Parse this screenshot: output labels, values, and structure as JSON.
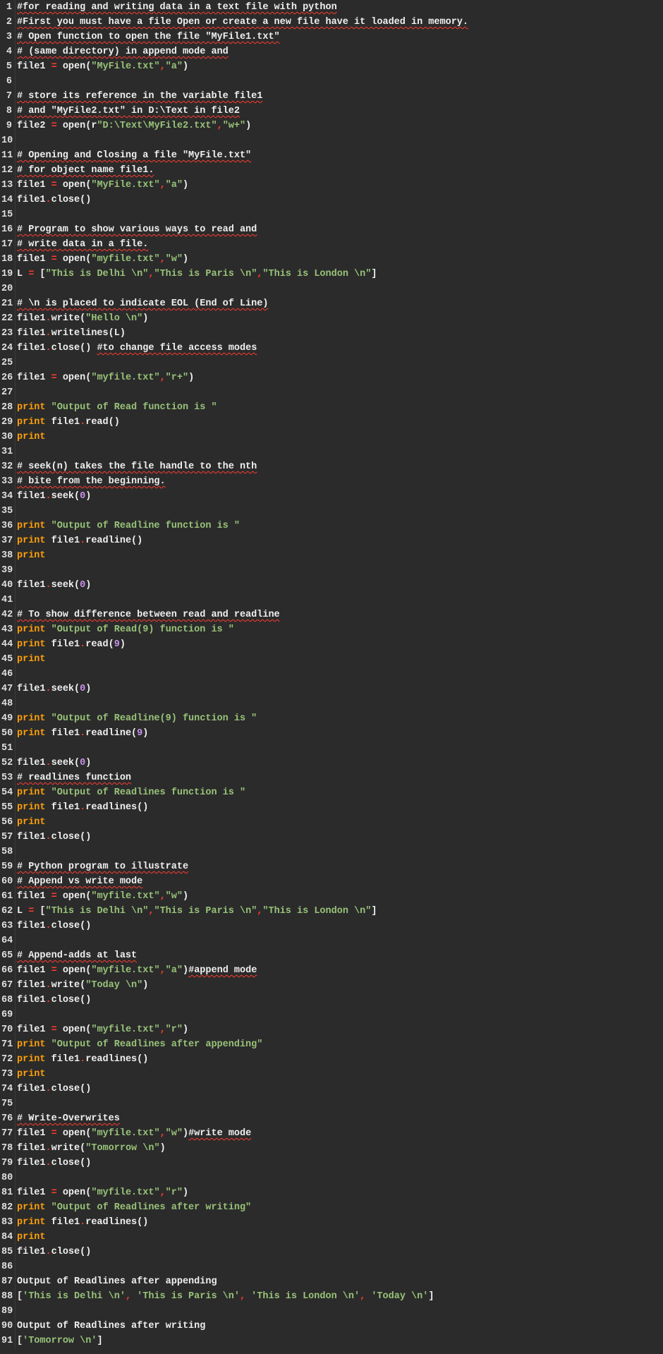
{
  "lines": [
    [
      [
        "comment squiggle",
        "#for reading and writing data in a text file with python"
      ]
    ],
    [
      [
        "comment squiggle",
        "#First you must have a file Open or create a new file have it loaded in memory."
      ]
    ],
    [
      [
        "comment squiggle",
        "# Open function to open the file \"MyFile1.txt\""
      ]
    ],
    [
      [
        "comment squiggle",
        "# (same directory) in append mode and"
      ]
    ],
    [
      [
        "ident",
        "file1 "
      ],
      [
        "op",
        "="
      ],
      [
        "ident",
        " open"
      ],
      [
        "paren",
        "("
      ],
      [
        "str",
        "\"MyFile.txt\""
      ],
      [
        "op",
        ","
      ],
      [
        "str",
        "\"a\""
      ],
      [
        "paren",
        ")"
      ]
    ],
    [
      [
        "ident",
        ""
      ]
    ],
    [
      [
        "comment squiggle",
        "# store its reference in the variable file1"
      ]
    ],
    [
      [
        "comment squiggle",
        "# and \"MyFile2.txt\" in D:\\Text in file2"
      ]
    ],
    [
      [
        "ident",
        "file2 "
      ],
      [
        "op",
        "="
      ],
      [
        "ident",
        " open"
      ],
      [
        "paren",
        "("
      ],
      [
        "ident",
        "r"
      ],
      [
        "str",
        "\"D:\\Text\\MyFile2.txt\""
      ],
      [
        "op",
        ","
      ],
      [
        "str",
        "\"w+\""
      ],
      [
        "paren",
        ")"
      ]
    ],
    [
      [
        "ident",
        ""
      ]
    ],
    [
      [
        "comment squiggle",
        "# Opening and Closing a file \"MyFile.txt\""
      ]
    ],
    [
      [
        "comment squiggle",
        "# for object name file1."
      ]
    ],
    [
      [
        "ident",
        "file1 "
      ],
      [
        "op",
        "="
      ],
      [
        "ident",
        " open"
      ],
      [
        "paren",
        "("
      ],
      [
        "str",
        "\"MyFile.txt\""
      ],
      [
        "op",
        ","
      ],
      [
        "str",
        "\"a\""
      ],
      [
        "paren",
        ")"
      ]
    ],
    [
      [
        "ident",
        "file1"
      ],
      [
        "op",
        "."
      ],
      [
        "ident",
        "close"
      ],
      [
        "paren",
        "()"
      ]
    ],
    [
      [
        "ident",
        ""
      ]
    ],
    [
      [
        "comment squiggle",
        "# Program to show various ways to read and"
      ]
    ],
    [
      [
        "comment squiggle",
        "# write data in a file."
      ]
    ],
    [
      [
        "ident",
        "file1 "
      ],
      [
        "op",
        "="
      ],
      [
        "ident",
        " open"
      ],
      [
        "paren",
        "("
      ],
      [
        "str",
        "\"myfile.txt\""
      ],
      [
        "op",
        ","
      ],
      [
        "str",
        "\"w\""
      ],
      [
        "paren",
        ")"
      ]
    ],
    [
      [
        "ident",
        "L "
      ],
      [
        "op",
        "="
      ],
      [
        "ident",
        " "
      ],
      [
        "paren",
        "["
      ],
      [
        "str",
        "\"This is Delhi \\n\""
      ],
      [
        "op",
        ","
      ],
      [
        "str",
        "\"This is Paris \\n\""
      ],
      [
        "op",
        ","
      ],
      [
        "str",
        "\"This is London \\n\""
      ],
      [
        "paren",
        "]"
      ]
    ],
    [
      [
        "ident",
        ""
      ]
    ],
    [
      [
        "comment squiggle",
        "# \\n is placed to indicate EOL (End of Line)"
      ]
    ],
    [
      [
        "ident",
        "file1"
      ],
      [
        "op",
        "."
      ],
      [
        "ident",
        "write"
      ],
      [
        "paren",
        "("
      ],
      [
        "str",
        "\"Hello \\n\""
      ],
      [
        "paren",
        ")"
      ]
    ],
    [
      [
        "ident",
        "file1"
      ],
      [
        "op",
        "."
      ],
      [
        "ident",
        "writelines"
      ],
      [
        "paren",
        "("
      ],
      [
        "ident",
        "L"
      ],
      [
        "paren",
        ")"
      ]
    ],
    [
      [
        "ident",
        "file1"
      ],
      [
        "op",
        "."
      ],
      [
        "ident",
        "close"
      ],
      [
        "paren",
        "() "
      ],
      [
        "comment squiggle",
        "#to change file access modes"
      ]
    ],
    [
      [
        "ident",
        ""
      ]
    ],
    [
      [
        "ident",
        "file1 "
      ],
      [
        "op",
        "="
      ],
      [
        "ident",
        " open"
      ],
      [
        "paren",
        "("
      ],
      [
        "str",
        "\"myfile.txt\""
      ],
      [
        "op",
        ","
      ],
      [
        "str",
        "\"r+\""
      ],
      [
        "paren",
        ")"
      ]
    ],
    [
      [
        "ident",
        ""
      ]
    ],
    [
      [
        "kw",
        "print "
      ],
      [
        "str",
        "\"Output of Read function is \""
      ]
    ],
    [
      [
        "kw",
        "print "
      ],
      [
        "ident",
        "file1"
      ],
      [
        "op",
        "."
      ],
      [
        "ident",
        "read"
      ],
      [
        "paren",
        "()"
      ]
    ],
    [
      [
        "kw",
        "print"
      ]
    ],
    [
      [
        "ident",
        ""
      ]
    ],
    [
      [
        "comment squiggle",
        "# seek(n) takes the file handle to the nth"
      ]
    ],
    [
      [
        "comment squiggle",
        "# bite from the beginning."
      ]
    ],
    [
      [
        "ident",
        "file1"
      ],
      [
        "op",
        "."
      ],
      [
        "ident",
        "seek"
      ],
      [
        "paren",
        "("
      ],
      [
        "numlit",
        "0"
      ],
      [
        "paren",
        ")"
      ]
    ],
    [
      [
        "ident",
        ""
      ]
    ],
    [
      [
        "kw",
        "print "
      ],
      [
        "str",
        "\"Output of Readline function is \""
      ]
    ],
    [
      [
        "kw",
        "print "
      ],
      [
        "ident",
        "file1"
      ],
      [
        "op",
        "."
      ],
      [
        "ident",
        "readline"
      ],
      [
        "paren",
        "()"
      ]
    ],
    [
      [
        "kw",
        "print"
      ]
    ],
    [
      [
        "ident",
        ""
      ]
    ],
    [
      [
        "ident",
        "file1"
      ],
      [
        "op",
        "."
      ],
      [
        "ident",
        "seek"
      ],
      [
        "paren",
        "("
      ],
      [
        "numlit",
        "0"
      ],
      [
        "paren",
        ")"
      ]
    ],
    [
      [
        "ident",
        ""
      ]
    ],
    [
      [
        "comment squiggle",
        "# To show difference between read and readline"
      ]
    ],
    [
      [
        "kw",
        "print "
      ],
      [
        "str",
        "\"Output of Read(9) function is \""
      ]
    ],
    [
      [
        "kw",
        "print "
      ],
      [
        "ident",
        "file1"
      ],
      [
        "op",
        "."
      ],
      [
        "ident",
        "read"
      ],
      [
        "paren",
        "("
      ],
      [
        "numlit",
        "9"
      ],
      [
        "paren",
        ")"
      ]
    ],
    [
      [
        "kw",
        "print"
      ]
    ],
    [
      [
        "ident",
        ""
      ]
    ],
    [
      [
        "ident",
        "file1"
      ],
      [
        "op",
        "."
      ],
      [
        "ident",
        "seek"
      ],
      [
        "paren",
        "("
      ],
      [
        "numlit",
        "0"
      ],
      [
        "paren",
        ")"
      ]
    ],
    [
      [
        "ident",
        ""
      ]
    ],
    [
      [
        "kw",
        "print "
      ],
      [
        "str",
        "\"Output of Readline(9) function is \""
      ]
    ],
    [
      [
        "kw",
        "print "
      ],
      [
        "ident",
        "file1"
      ],
      [
        "op",
        "."
      ],
      [
        "ident",
        "readline"
      ],
      [
        "paren",
        "("
      ],
      [
        "numlit",
        "9"
      ],
      [
        "paren",
        ")"
      ]
    ],
    [
      [
        "ident",
        ""
      ]
    ],
    [
      [
        "ident",
        "file1"
      ],
      [
        "op",
        "."
      ],
      [
        "ident",
        "seek"
      ],
      [
        "paren",
        "("
      ],
      [
        "numlit",
        "0"
      ],
      [
        "paren",
        ")"
      ]
    ],
    [
      [
        "comment squiggle",
        "# readlines function"
      ]
    ],
    [
      [
        "kw",
        "print "
      ],
      [
        "str",
        "\"Output of Readlines function is \""
      ]
    ],
    [
      [
        "kw",
        "print "
      ],
      [
        "ident",
        "file1"
      ],
      [
        "op",
        "."
      ],
      [
        "ident",
        "readlines"
      ],
      [
        "paren",
        "()"
      ]
    ],
    [
      [
        "kw",
        "print"
      ]
    ],
    [
      [
        "ident",
        "file1"
      ],
      [
        "op",
        "."
      ],
      [
        "ident",
        "close"
      ],
      [
        "paren",
        "()"
      ]
    ],
    [
      [
        "ident",
        ""
      ]
    ],
    [
      [
        "comment squiggle",
        "# Python program to illustrate"
      ]
    ],
    [
      [
        "comment squiggle",
        "# Append vs write mode"
      ]
    ],
    [
      [
        "ident",
        "file1 "
      ],
      [
        "op",
        "="
      ],
      [
        "ident",
        " open"
      ],
      [
        "paren",
        "("
      ],
      [
        "str",
        "\"myfile.txt\""
      ],
      [
        "op",
        ","
      ],
      [
        "str",
        "\"w\""
      ],
      [
        "paren",
        ")"
      ]
    ],
    [
      [
        "ident",
        "L "
      ],
      [
        "op",
        "="
      ],
      [
        "ident",
        " "
      ],
      [
        "paren",
        "["
      ],
      [
        "str",
        "\"This is Delhi \\n\""
      ],
      [
        "op",
        ","
      ],
      [
        "str",
        "\"This is Paris \\n\""
      ],
      [
        "op",
        ","
      ],
      [
        "str",
        "\"This is London \\n\""
      ],
      [
        "paren",
        "]"
      ]
    ],
    [
      [
        "ident",
        "file1"
      ],
      [
        "op",
        "."
      ],
      [
        "ident",
        "close"
      ],
      [
        "paren",
        "()"
      ]
    ],
    [
      [
        "ident",
        ""
      ]
    ],
    [
      [
        "comment squiggle",
        "# Append-adds at last"
      ]
    ],
    [
      [
        "ident",
        "file1 "
      ],
      [
        "op",
        "="
      ],
      [
        "ident",
        " open"
      ],
      [
        "paren",
        "("
      ],
      [
        "str",
        "\"myfile.txt\""
      ],
      [
        "op",
        ","
      ],
      [
        "str",
        "\"a\""
      ],
      [
        "paren",
        ")"
      ],
      [
        "comment squiggle",
        "#append mode"
      ]
    ],
    [
      [
        "ident",
        "file1"
      ],
      [
        "op",
        "."
      ],
      [
        "ident",
        "write"
      ],
      [
        "paren",
        "("
      ],
      [
        "str",
        "\"Today \\n\""
      ],
      [
        "paren",
        ")"
      ]
    ],
    [
      [
        "ident",
        "file1"
      ],
      [
        "op",
        "."
      ],
      [
        "ident",
        "close"
      ],
      [
        "paren",
        "()"
      ]
    ],
    [
      [
        "ident",
        ""
      ]
    ],
    [
      [
        "ident",
        "file1 "
      ],
      [
        "op",
        "="
      ],
      [
        "ident",
        " open"
      ],
      [
        "paren",
        "("
      ],
      [
        "str",
        "\"myfile.txt\""
      ],
      [
        "op",
        ","
      ],
      [
        "str",
        "\"r\""
      ],
      [
        "paren",
        ")"
      ]
    ],
    [
      [
        "kw",
        "print "
      ],
      [
        "str",
        "\"Output of Readlines after appending\""
      ]
    ],
    [
      [
        "kw",
        "print "
      ],
      [
        "ident",
        "file1"
      ],
      [
        "op",
        "."
      ],
      [
        "ident",
        "readlines"
      ],
      [
        "paren",
        "()"
      ]
    ],
    [
      [
        "kw",
        "print"
      ]
    ],
    [
      [
        "ident",
        "file1"
      ],
      [
        "op",
        "."
      ],
      [
        "ident",
        "close"
      ],
      [
        "paren",
        "()"
      ]
    ],
    [
      [
        "ident",
        ""
      ]
    ],
    [
      [
        "comment squiggle",
        "# Write-Overwrites"
      ]
    ],
    [
      [
        "ident",
        "file1 "
      ],
      [
        "op",
        "="
      ],
      [
        "ident",
        " open"
      ],
      [
        "paren",
        "("
      ],
      [
        "str",
        "\"myfile.txt\""
      ],
      [
        "op",
        ","
      ],
      [
        "str",
        "\"w\""
      ],
      [
        "paren",
        ")"
      ],
      [
        "comment squiggle",
        "#write mode"
      ]
    ],
    [
      [
        "ident",
        "file1"
      ],
      [
        "op",
        "."
      ],
      [
        "ident",
        "write"
      ],
      [
        "paren",
        "("
      ],
      [
        "str",
        "\"Tomorrow \\n\""
      ],
      [
        "paren",
        ")"
      ]
    ],
    [
      [
        "ident",
        "file1"
      ],
      [
        "op",
        "."
      ],
      [
        "ident",
        "close"
      ],
      [
        "paren",
        "()"
      ]
    ],
    [
      [
        "ident",
        ""
      ]
    ],
    [
      [
        "ident",
        "file1 "
      ],
      [
        "op",
        "="
      ],
      [
        "ident",
        " open"
      ],
      [
        "paren",
        "("
      ],
      [
        "str",
        "\"myfile.txt\""
      ],
      [
        "op",
        ","
      ],
      [
        "str",
        "\"r\""
      ],
      [
        "paren",
        ")"
      ]
    ],
    [
      [
        "kw",
        "print "
      ],
      [
        "str",
        "\"Output of Readlines after writing\""
      ]
    ],
    [
      [
        "kw",
        "print "
      ],
      [
        "ident",
        "file1"
      ],
      [
        "op",
        "."
      ],
      [
        "ident",
        "readlines"
      ],
      [
        "paren",
        "()"
      ]
    ],
    [
      [
        "kw",
        "print"
      ]
    ],
    [
      [
        "ident",
        "file1"
      ],
      [
        "op",
        "."
      ],
      [
        "ident",
        "close"
      ],
      [
        "paren",
        "()"
      ]
    ],
    [
      [
        "ident",
        ""
      ]
    ],
    [
      [
        "ident",
        "Output of Readlines after appending"
      ]
    ],
    [
      [
        "paren",
        "["
      ],
      [
        "str",
        "'This is Delhi \\n'"
      ],
      [
        "op",
        ", "
      ],
      [
        "str",
        "'This is Paris \\n'"
      ],
      [
        "op",
        ", "
      ],
      [
        "str",
        "'This is London \\n'"
      ],
      [
        "op",
        ", "
      ],
      [
        "str",
        "'Today \\n'"
      ],
      [
        "paren",
        "]"
      ]
    ],
    [
      [
        "ident",
        ""
      ]
    ],
    [
      [
        "ident",
        "Output of Readlines after writing"
      ]
    ],
    [
      [
        "paren",
        "["
      ],
      [
        "str",
        "'Tomorrow \\n'"
      ],
      [
        "paren",
        "]"
      ]
    ]
  ]
}
